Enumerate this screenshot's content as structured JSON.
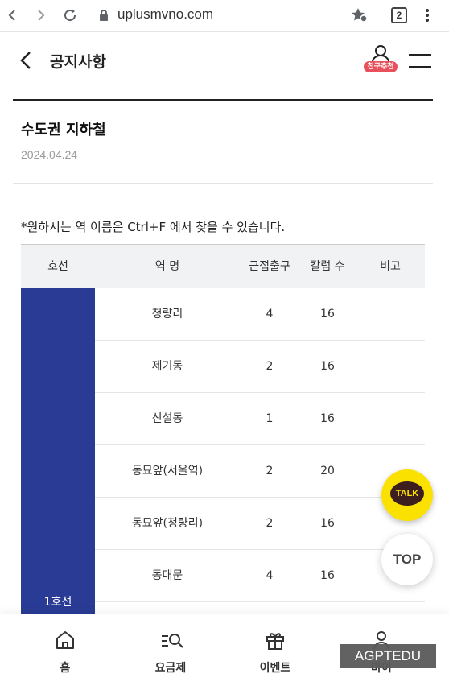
{
  "browser": {
    "url": "uplusmvno.com",
    "tab_count": "2"
  },
  "header": {
    "title": "공지사항",
    "friend_badge": "친구추천"
  },
  "notice": {
    "title": "수도권 지하철",
    "date": "2024.04.24",
    "note": "*원하시는 역 이름은 Ctrl+F 에서 찾을 수 있습니다."
  },
  "table": {
    "headers": [
      "호선",
      "역 명",
      "근접출구",
      "칼럼 수",
      "비고"
    ],
    "line_label": "1호선",
    "line_color": "#293b94",
    "rows": [
      {
        "station": "청량리",
        "exit": "4",
        "columns": "16",
        "note": ""
      },
      {
        "station": "제기동",
        "exit": "2",
        "columns": "16",
        "note": ""
      },
      {
        "station": "신설동",
        "exit": "1",
        "columns": "16",
        "note": ""
      },
      {
        "station": "동묘앞(서울역)",
        "exit": "2",
        "columns": "20",
        "note": ""
      },
      {
        "station": "동묘앞(청량리)",
        "exit": "2",
        "columns": "16",
        "note": ""
      },
      {
        "station": "동대문",
        "exit": "4",
        "columns": "16",
        "note": ""
      }
    ]
  },
  "floating": {
    "talk_label": "TALK",
    "top_label": "TOP"
  },
  "bottom_nav": {
    "items": [
      {
        "label": "홈",
        "icon": "home-icon"
      },
      {
        "label": "요금제",
        "icon": "plan-search-icon"
      },
      {
        "label": "이벤트",
        "icon": "gift-icon"
      },
      {
        "label": "마이",
        "icon": "user-icon"
      }
    ]
  },
  "watermark": "AGPTEDU"
}
